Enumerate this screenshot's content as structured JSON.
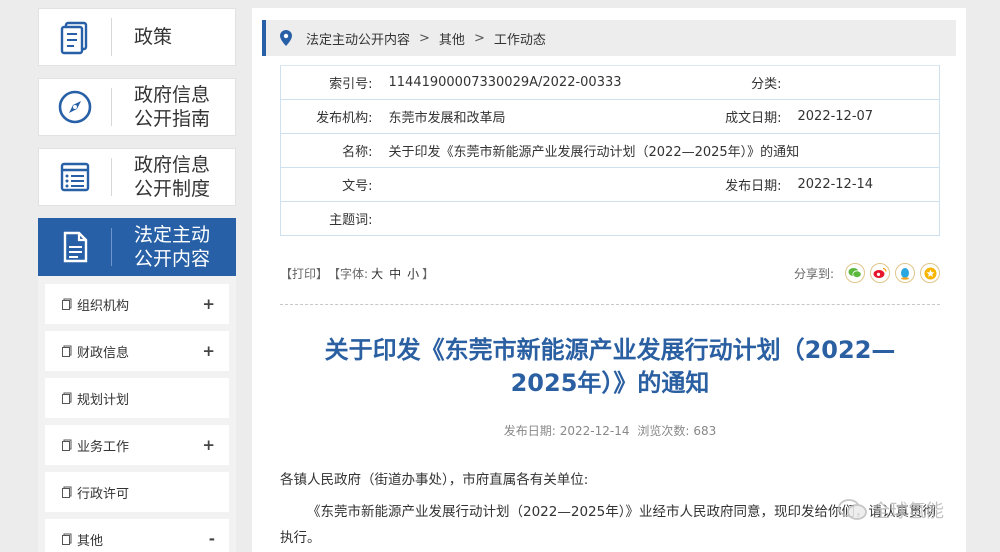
{
  "sidebar": {
    "main_nav": [
      {
        "label": "政策",
        "icon": "policy-doc-icon"
      },
      {
        "label": "政府信息\n公开指南",
        "icon": "compass-icon"
      },
      {
        "label": "政府信息\n公开制度",
        "icon": "list-doc-icon"
      },
      {
        "label": "法定主动\n公开内容",
        "icon": "document-icon",
        "active": true
      }
    ],
    "sub_items": [
      {
        "label": "组织机构",
        "toggle": "+"
      },
      {
        "label": "财政信息",
        "toggle": "+"
      },
      {
        "label": "规划计划",
        "toggle": ""
      },
      {
        "label": "业务工作",
        "toggle": "+"
      },
      {
        "label": "行政许可",
        "toggle": ""
      },
      {
        "label": "其他",
        "toggle": "-"
      }
    ]
  },
  "breadcrumb": {
    "items": [
      "法定主动公开内容",
      "其他",
      "工作动态"
    ],
    "separator": ">"
  },
  "meta": {
    "index_label": "索引号:",
    "index_value": "11441900007330029A/2022-00333",
    "category_label": "分类:",
    "category_value": "",
    "publisher_label": "发布机构:",
    "publisher_value": "东莞市发展和改革局",
    "created_label": "成文日期:",
    "created_value": "2022-12-07",
    "name_label": "名称:",
    "name_value": "关于印发《东莞市新能源产业发展行动计划（2022—2025年）》的通知",
    "docno_label": "文号:",
    "docno_value": "",
    "published_label": "发布日期:",
    "published_value": "2022-12-14",
    "subject_label": "主题词:",
    "subject_value": ""
  },
  "tools": {
    "print": "【打印】",
    "font_label": "【字体:",
    "size_large": "大",
    "size_medium": "中",
    "size_small": "小",
    "font_close": "】",
    "share_label": "分享到:"
  },
  "article": {
    "title_line1": "关于印发《东莞市新能源产业发展行动计划（2022—",
    "title_line2": "2025年）》的通知",
    "pub_date_label": "发布日期:",
    "pub_date": "2022-12-14",
    "views_label": "浏览次数:",
    "views": "683",
    "greeting": "各镇人民政府（街道办事处），市府直属各有关单位:",
    "para1": "《东莞市新能源产业发展行动计划（2022—2025年）》业经市人民政府同意，现印发给你们，请认真贯彻执行。"
  },
  "watermark": {
    "text": "全球氢能"
  },
  "colors": {
    "accent": "#2760a6",
    "title": "#2a5fa2"
  }
}
